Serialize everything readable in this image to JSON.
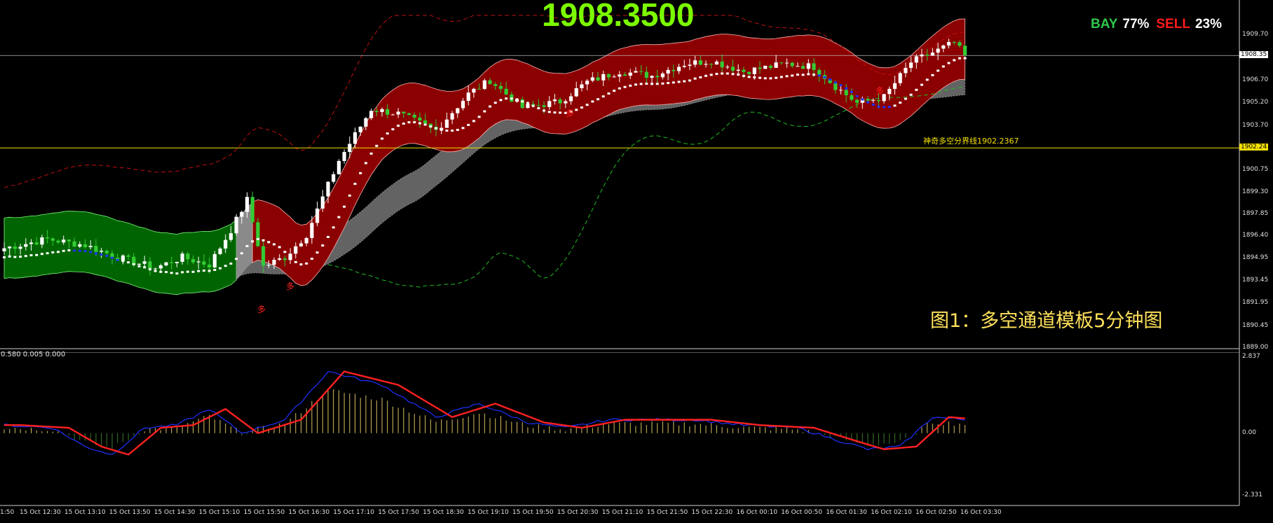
{
  "header": {
    "big_price": "1908.3500",
    "bay_label": "BAY",
    "bay_pct": "77%",
    "sell_label": "SELL",
    "sell_pct": "23%"
  },
  "caption": "图1：多空通道模板5分钟图",
  "boundary_label": "神奇多空分界线1902.2367",
  "oscillator_label": "0.580 0.005 0.000",
  "signal_marks": [
    "多",
    "多",
    "多",
    "多"
  ],
  "colors": {
    "background": "#000000",
    "bull_candle": "#ffffff",
    "bear_candle": "#33cc33",
    "bull_channel": "#8b0000",
    "bear_channel": "#006400",
    "cloud": "#6e6e6e",
    "boundary_line": "#f4e000",
    "price_text": "#7cfc00",
    "bay_text": "#2ec84a",
    "sell_text": "#ff1a1a",
    "signal_line": "#ff2020",
    "macd_line": "#2030ff"
  },
  "chart_data": {
    "type": "candlestick",
    "symbol_price": 1908.35,
    "price_axis": {
      "ylim": [
        1889.0,
        1911.0
      ],
      "ticks": [
        "1909.70",
        "1908.20",
        "1906.70",
        "1905.20",
        "1903.70",
        "1902.24",
        "1900.75",
        "1899.30",
        "1897.85",
        "1896.40",
        "1894.95",
        "1893.45",
        "1891.95",
        "1890.45",
        "1889.00"
      ],
      "current_tag": "1908.35",
      "boundary_tag": "1902.24",
      "boundary_value": 1902.2367
    },
    "oscillator_axis": {
      "ticks": [
        "2.837",
        "0.00",
        "-2.331"
      ]
    },
    "time_labels": [
      "1:50",
      "15 Oct 12:30",
      "15 Oct 13:10",
      "15 Oct 13:50",
      "15 Oct 14:30",
      "15 Oct 15:10",
      "15 Oct 15:50",
      "15 Oct 16:30",
      "15 Oct 17:10",
      "15 Oct 17:50",
      "15 Oct 18:30",
      "15 Oct 19:10",
      "15 Oct 19:50",
      "15 Oct 20:30",
      "15 Oct 21:10",
      "15 Oct 21:50",
      "15 Oct 22:30",
      "16 Oct 00:10",
      "16 Oct 00:50",
      "16 Oct 01:30",
      "16 Oct 02:10",
      "16 Oct 02:50",
      "16 Oct 03:30"
    ],
    "close_path": [
      [
        0,
        1895.6
      ],
      [
        8,
        1896.2
      ],
      [
        15,
        1895.8
      ],
      [
        21,
        1895.0
      ],
      [
        28,
        1894.3
      ],
      [
        33,
        1895.0
      ],
      [
        38,
        1894.5
      ],
      [
        42,
        1896.8
      ],
      [
        45,
        1898.8
      ],
      [
        48,
        1894.4
      ],
      [
        52,
        1895.0
      ],
      [
        56,
        1896.5
      ],
      [
        62,
        1901.4
      ],
      [
        68,
        1904.8
      ],
      [
        73,
        1904.5
      ],
      [
        80,
        1903.4
      ],
      [
        86,
        1905.8
      ],
      [
        90,
        1906.7
      ],
      [
        96,
        1904.9
      ],
      [
        103,
        1905.3
      ],
      [
        108,
        1906.6
      ],
      [
        114,
        1907.3
      ],
      [
        120,
        1907.0
      ],
      [
        126,
        1907.8
      ],
      [
        131,
        1908.0
      ],
      [
        137,
        1907.3
      ],
      [
        145,
        1907.8
      ],
      [
        150,
        1907.6
      ],
      [
        154,
        1906.3
      ],
      [
        158,
        1905.2
      ],
      [
        163,
        1905.6
      ],
      [
        168,
        1907.9
      ],
      [
        173,
        1908.7
      ],
      [
        176,
        1909.2
      ],
      [
        178,
        1908.3
      ]
    ],
    "macd_series": [
      [
        0,
        0.3
      ],
      [
        9,
        0.2
      ],
      [
        15,
        -0.5
      ],
      [
        20,
        -0.8
      ],
      [
        26,
        0.2
      ],
      [
        32,
        0.3
      ],
      [
        38,
        0.9
      ],
      [
        44,
        0.0
      ],
      [
        52,
        0.5
      ],
      [
        60,
        2.3
      ],
      [
        70,
        1.8
      ],
      [
        80,
        0.6
      ],
      [
        88,
        1.1
      ],
      [
        97,
        0.4
      ],
      [
        104,
        0.2
      ],
      [
        112,
        0.5
      ],
      [
        120,
        0.5
      ],
      [
        128,
        0.5
      ],
      [
        137,
        0.3
      ],
      [
        147,
        0.2
      ],
      [
        155,
        -0.3
      ],
      [
        160,
        -0.6
      ],
      [
        166,
        -0.5
      ],
      [
        172,
        0.6
      ],
      [
        178,
        0.5
      ]
    ]
  }
}
